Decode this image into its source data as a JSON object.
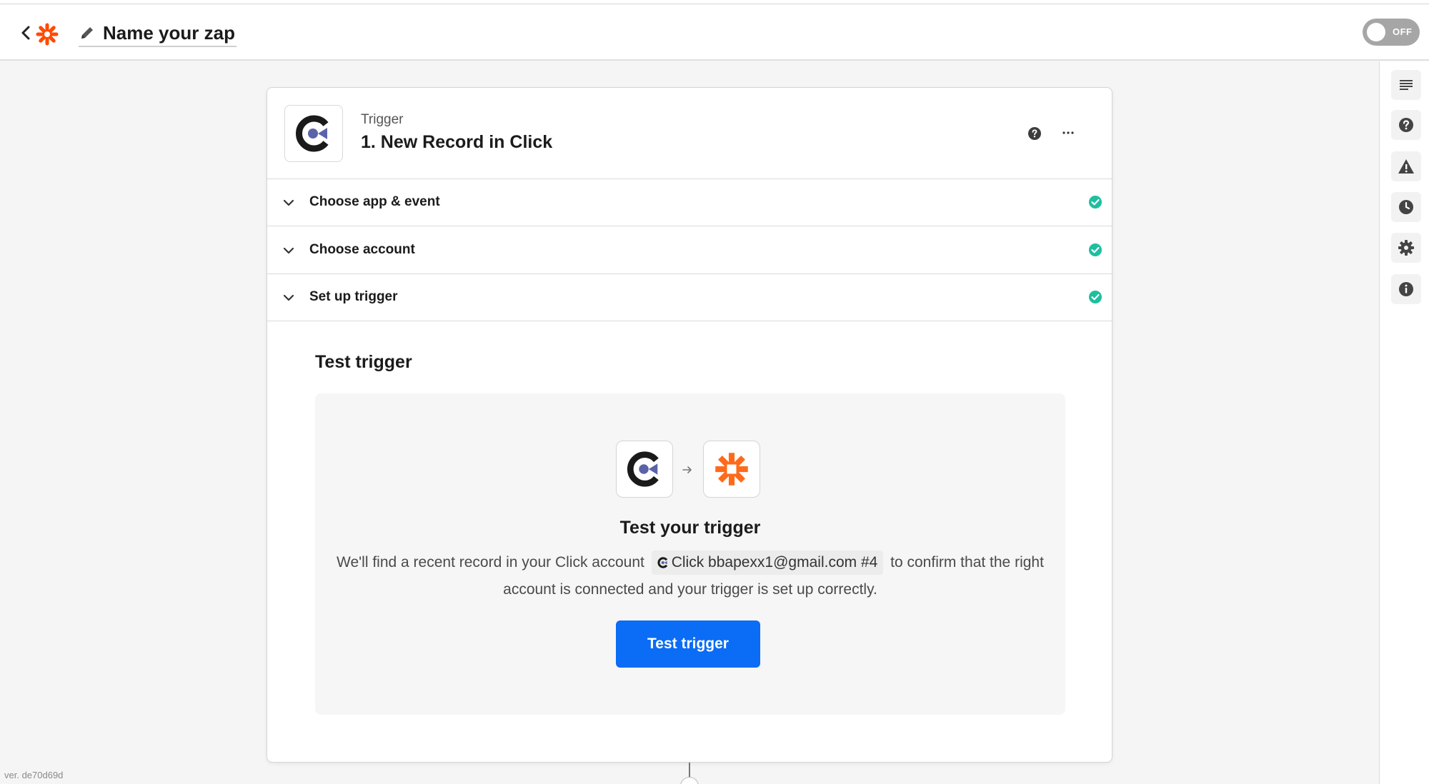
{
  "header": {
    "zap_name": "Name your zap",
    "toggle_label": "OFF"
  },
  "trigger": {
    "label": "Trigger",
    "title": "1. New Record in Click"
  },
  "steps": [
    {
      "label": "Choose app & event",
      "status": "complete"
    },
    {
      "label": "Choose account",
      "status": "complete"
    },
    {
      "label": "Set up trigger",
      "status": "complete"
    }
  ],
  "test": {
    "section_title": "Test trigger",
    "panel_title": "Test your trigger",
    "desc_before": "We'll find a recent record in your Click account",
    "account_chip": "Click bbapexx1@gmail.com #4",
    "desc_after": "to confirm that the right account is connected and your trigger is set up correctly.",
    "button_label": "Test trigger"
  },
  "sidebar_icons": [
    "outline-icon",
    "help-icon",
    "warning-icon",
    "history-icon",
    "settings-icon",
    "info-icon"
  ],
  "version": "ver. de70d69d",
  "colors": {
    "zapier_orange": "#ff4a00",
    "primary_button": "#0b6cf5",
    "success_green": "#1dbf9f",
    "toggle_off": "#a6a6a6"
  }
}
